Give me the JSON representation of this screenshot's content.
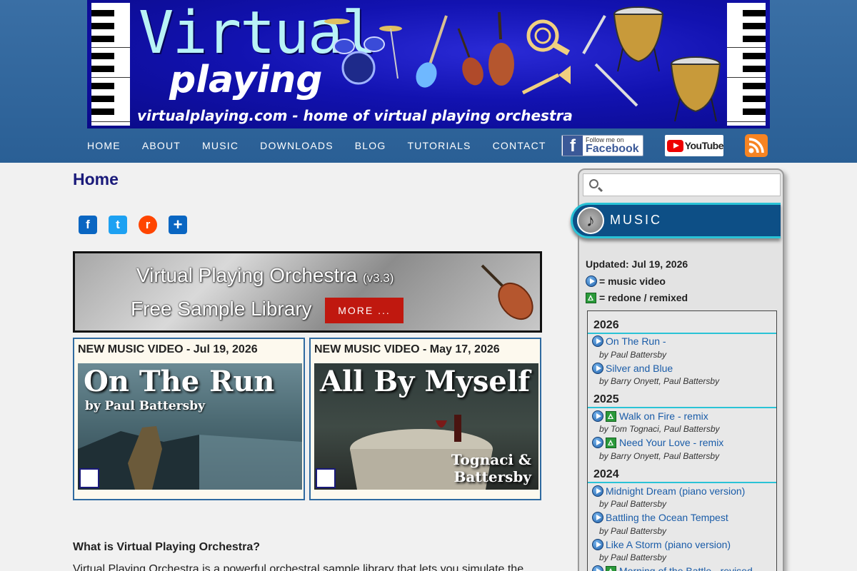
{
  "header": {
    "brand_title": "Virtual",
    "brand_subtitle": "playing",
    "brand_url": "virtualplaying.com - home of virtual playing orchestra"
  },
  "nav": [
    "HOME",
    "ABOUT",
    "MUSIC",
    "DOWNLOADS",
    "BLOG",
    "TUTORIALS",
    "CONTACT"
  ],
  "social": {
    "facebook_small": "Follow me on",
    "facebook_big": "Facebook",
    "youtube": "YouTube"
  },
  "main": {
    "page_title": "Home",
    "promo": {
      "line1": "Virtual Playing Orchestra",
      "version": "(v3.3)",
      "line2": "Free Sample Library",
      "button": "MORE ..."
    },
    "videos": [
      {
        "heading": "NEW MUSIC VIDEO - Jul 19, 2026",
        "thumb_title": "On The Run",
        "thumb_sub": "by Paul Battersby"
      },
      {
        "heading": "NEW MUSIC VIDEO - May 17, 2026",
        "thumb_title": "All By Myself",
        "thumb_credit_1": "Tognaci &",
        "thumb_credit_2": "Battersby"
      }
    ],
    "what_heading": "What is Virtual Playing Orchestra?",
    "what_text": "Virtual Playing Orchestra is a powerful orchestral sample library that lets you simulate the"
  },
  "sidebar": {
    "search_placeholder": "",
    "section_title": "MUSIC",
    "updated": "Updated: Jul 19, 2026",
    "legend_video": "= music video",
    "legend_remix": "= redone / remixed",
    "years": [
      "2026",
      "2025",
      "2024"
    ],
    "tracks": [
      {
        "title": "On The Run -",
        "by": "by Paul Battersby"
      },
      {
        "title": "Silver and Blue",
        "by": "by Barry Onyett, Paul Battersby"
      },
      {
        "title": "Walk on Fire - remix",
        "by": "by Tom Tognaci, Paul Battersby"
      },
      {
        "title": "Need Your Love - remix",
        "by": "by Barry Onyett, Paul Battersby"
      },
      {
        "title": "Midnight Dream (piano version)",
        "by": "by Paul Battersby"
      },
      {
        "title": "Battling the Ocean Tempest",
        "by": "by Paul Battersby"
      },
      {
        "title": "Like A Storm (piano version)",
        "by": "by Paul Battersby"
      },
      {
        "title": "Morning of the Battle - revised",
        "by": ""
      }
    ]
  },
  "colors": {
    "header_bg": "#2a5f95",
    "banner_bg": "#1212b0",
    "accent_cyan": "#2ac3d6",
    "more_button": "#c0180f",
    "link": "#1a5ca8"
  }
}
